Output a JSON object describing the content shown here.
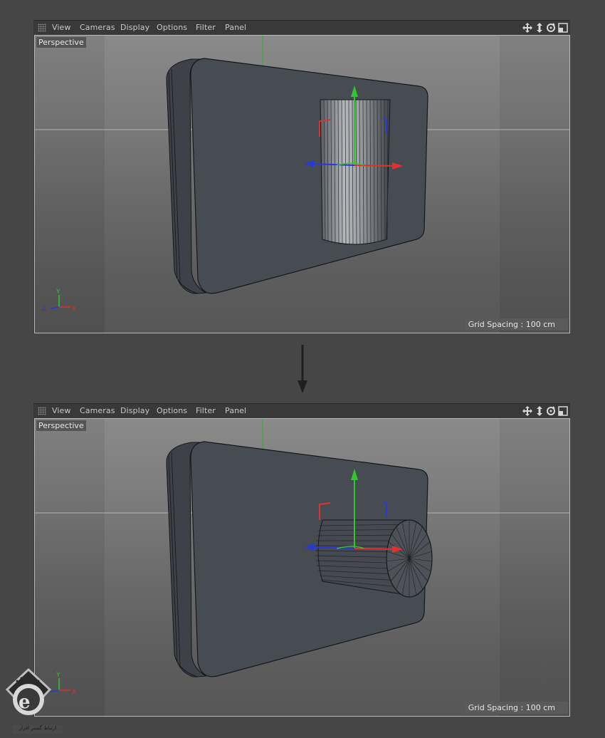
{
  "viewports": [
    {
      "menu": [
        "View",
        "Cameras",
        "Display",
        "Options",
        "Filter",
        "Panel"
      ],
      "camera_label": "Perspective",
      "grid_spacing": "Grid Spacing : 100 cm",
      "axis": {
        "y": "Y",
        "z": "Z",
        "x": "X"
      },
      "cylinder_orientation": "vertical"
    },
    {
      "menu": [
        "View",
        "Cameras",
        "Display",
        "Options",
        "Filter",
        "Panel"
      ],
      "camera_label": "Perspective",
      "grid_spacing": "Grid Spacing : 100 cm",
      "axis": {
        "y": "Y",
        "z": "Z",
        "x": "X"
      },
      "cylinder_orientation": "horizontal"
    }
  ],
  "nav_icons": [
    "move-view-icon",
    "dolly-view-icon",
    "rotate-view-icon",
    "maximize-view-icon"
  ],
  "colors": {
    "x_axis": "#e03030",
    "y_axis": "#2ec82e",
    "z_axis": "#2a3ad0",
    "model": "#474c53",
    "model_edge": "#15181b"
  },
  "watermark": "ارتباط گستر افزار"
}
